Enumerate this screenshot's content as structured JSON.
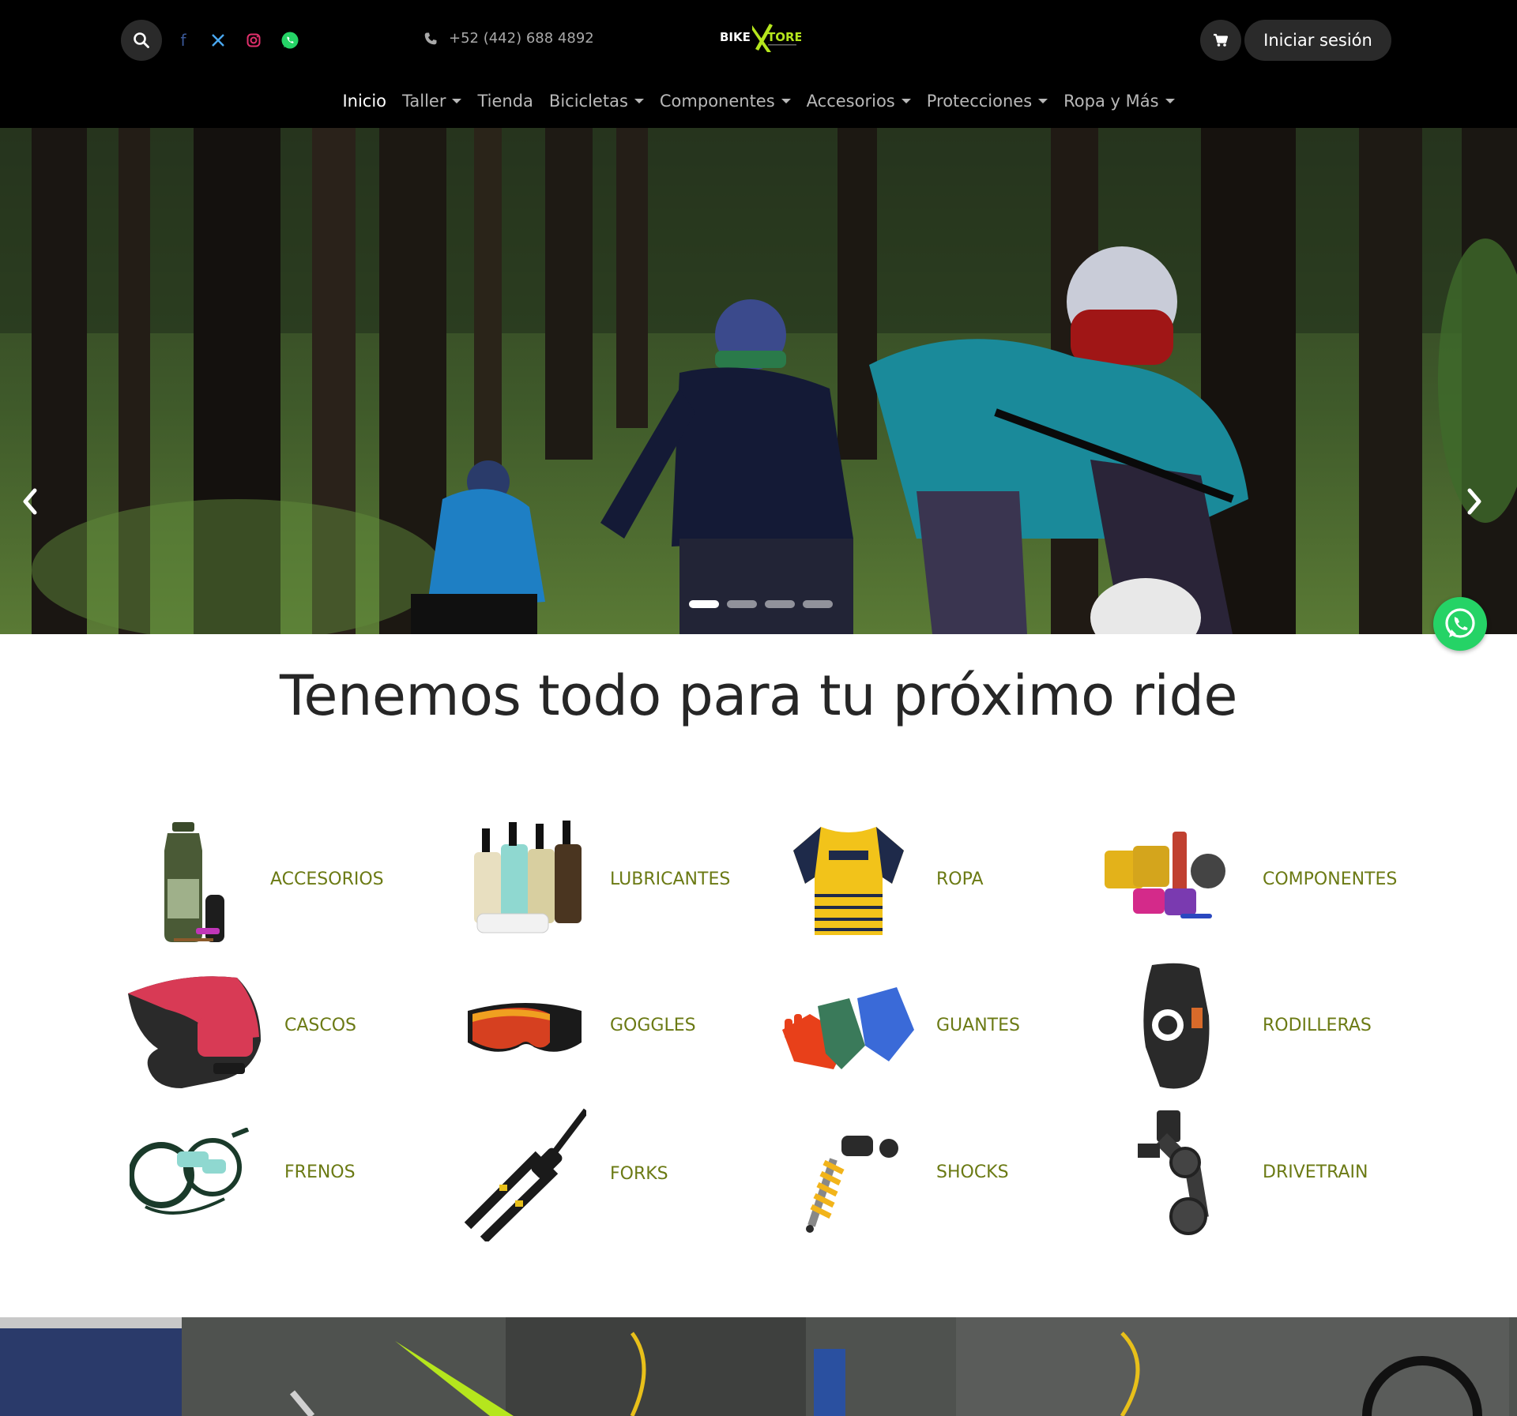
{
  "header": {
    "phone": "+52 (442) 688 4892",
    "logo_text_left": "BIKE",
    "logo_text_right": "TORE",
    "login_label": "Iniciar sesión",
    "socials": [
      {
        "name": "facebook",
        "glyph": "f",
        "color": "#3b5998"
      },
      {
        "name": "x",
        "glyph": "𝕏",
        "color": "#1da1f2"
      },
      {
        "name": "instagram",
        "glyph": "◎",
        "color": "#e1306c"
      },
      {
        "name": "whatsapp",
        "glyph": "✆",
        "color": "#25d366"
      }
    ]
  },
  "nav": {
    "items": [
      {
        "label": "Inicio",
        "dropdown": false,
        "active": true
      },
      {
        "label": "Taller",
        "dropdown": true
      },
      {
        "label": "Tienda",
        "dropdown": false
      },
      {
        "label": "Bicicletas",
        "dropdown": true
      },
      {
        "label": "Componentes",
        "dropdown": true
      },
      {
        "label": "Accesorios",
        "dropdown": true
      },
      {
        "label": "Protecciones",
        "dropdown": true
      },
      {
        "label": "Ropa y Más",
        "dropdown": true
      }
    ]
  },
  "hero": {
    "slides_count": 4,
    "active_slide": 1
  },
  "main": {
    "headline": "Tenemos todo para tu próximo ride"
  },
  "categories": [
    {
      "label": "ACCESORIOS",
      "icon": "water-bottle-icon"
    },
    {
      "label": "LUBRICANTES",
      "icon": "lube-bottles-icon"
    },
    {
      "label": "ROPA",
      "icon": "jersey-icon"
    },
    {
      "label": "COMPONENTES",
      "icon": "pedals-icon"
    },
    {
      "label": "CASCOS",
      "icon": "helmet-icon"
    },
    {
      "label": "GOGGLES",
      "icon": "goggles-icon"
    },
    {
      "label": "GUANTES",
      "icon": "gloves-icon"
    },
    {
      "label": "RODILLERAS",
      "icon": "knee-pad-icon"
    },
    {
      "label": "FRENOS",
      "icon": "brakes-icon"
    },
    {
      "label": "FORKS",
      "icon": "fork-icon"
    },
    {
      "label": "SHOCKS",
      "icon": "shock-icon"
    },
    {
      "label": "DRIVETRAIN",
      "icon": "derailleur-icon"
    }
  ],
  "colors": {
    "header_bg": "#000000",
    "category_text": "#6b7a14",
    "logo_accent": "#b5e61d",
    "whatsapp": "#25d366"
  }
}
